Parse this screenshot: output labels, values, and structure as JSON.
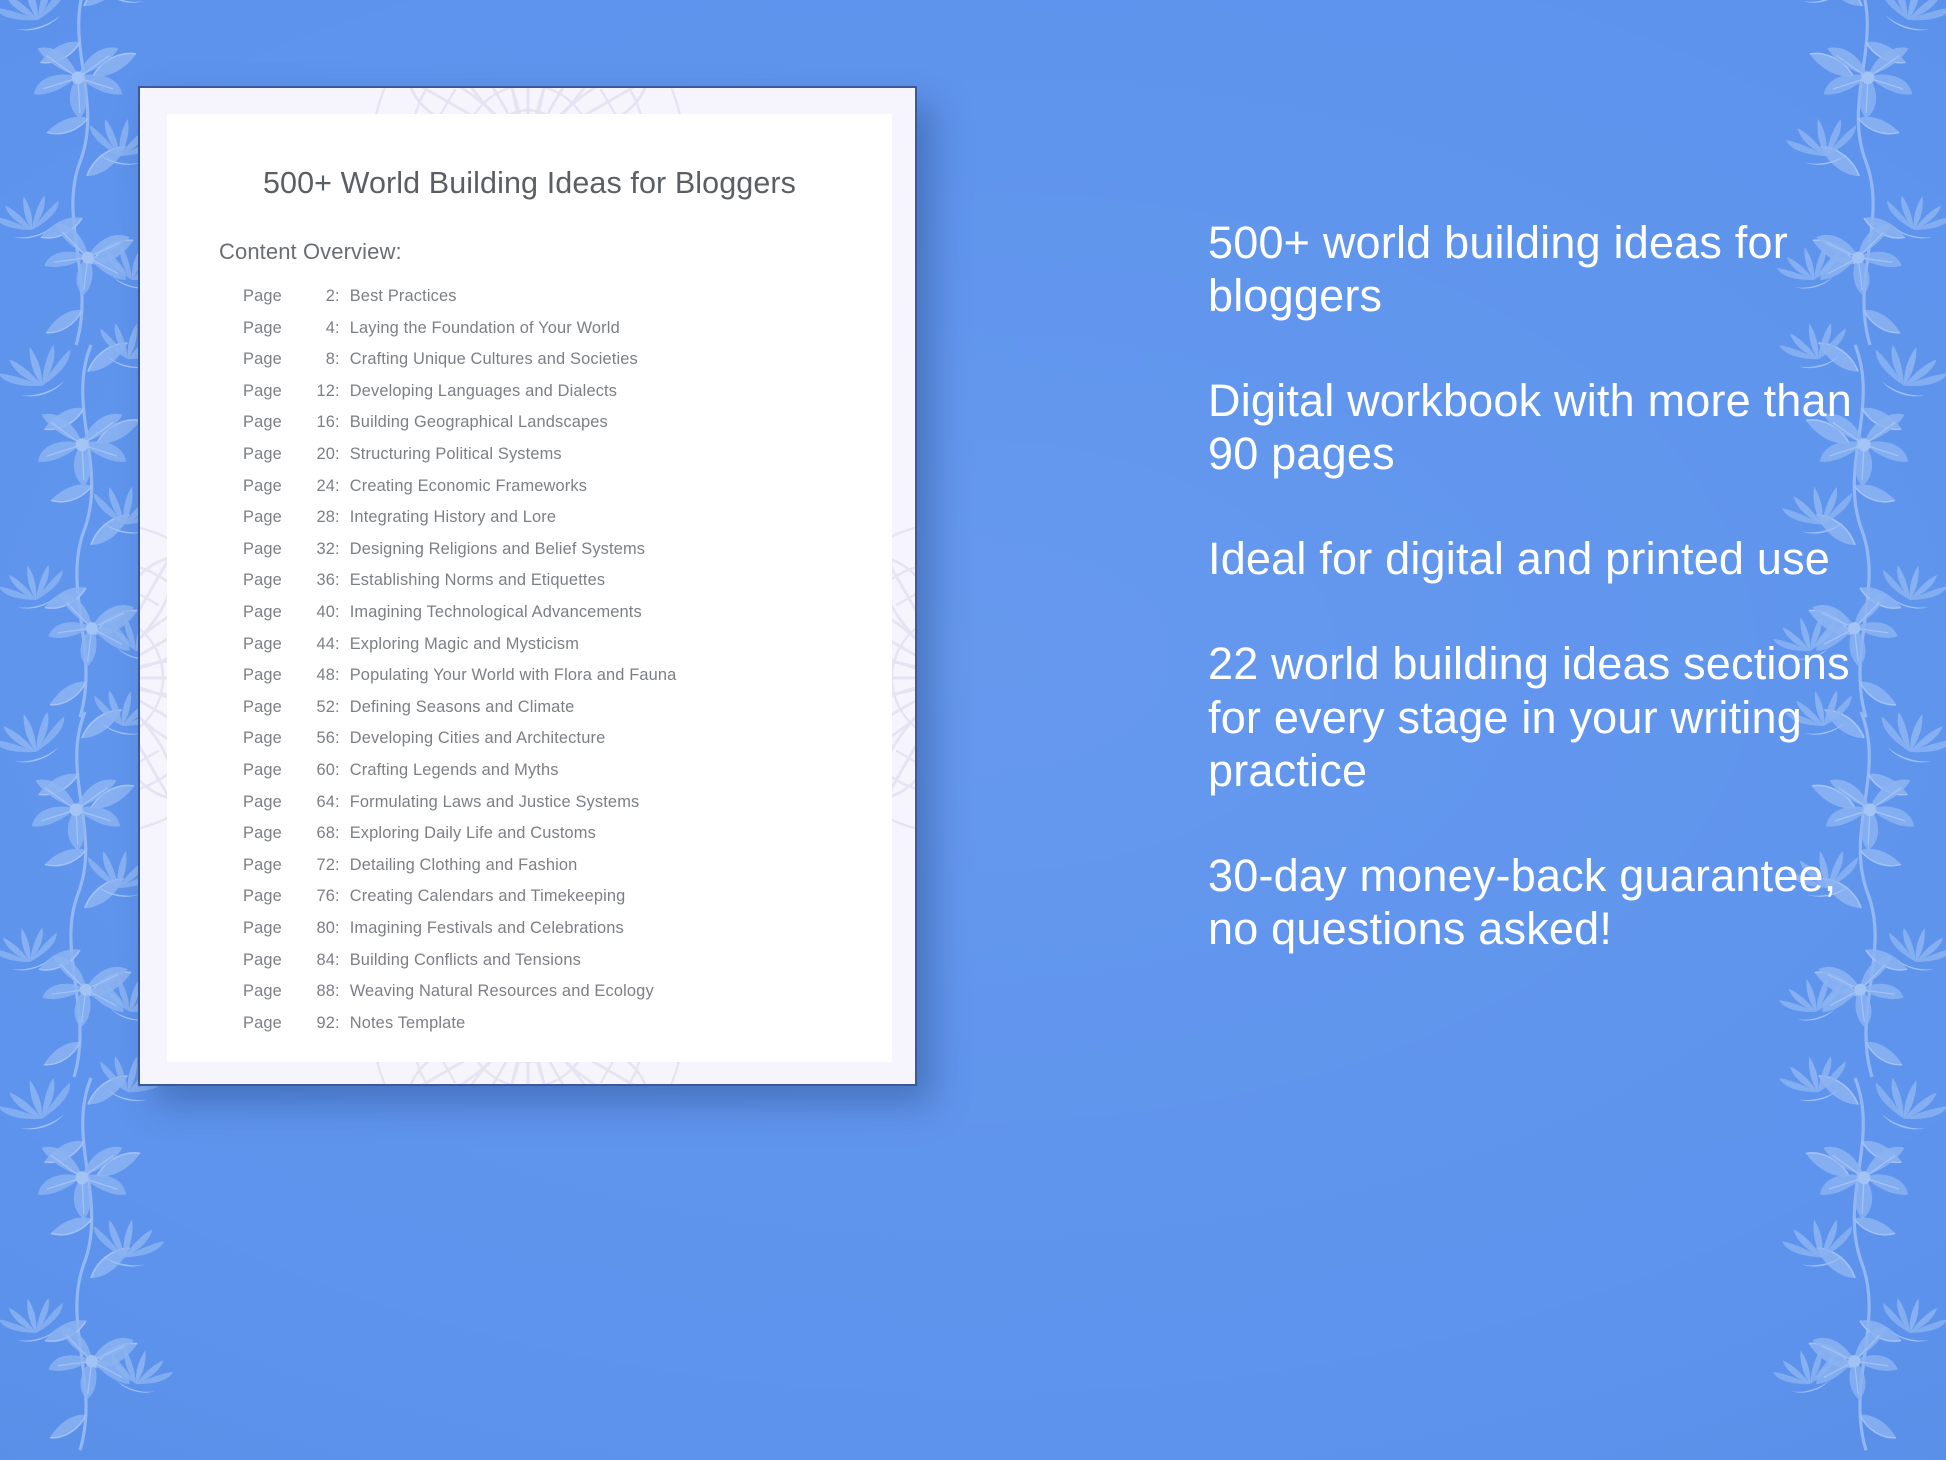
{
  "colors": {
    "background_blue": "#5d93ed",
    "floral_ornament": "#a9c8f5",
    "card_mat": "#f6f4fc",
    "card_border": "#3a5a9b",
    "page_white": "#ffffff",
    "title_text": "#5b5f63",
    "body_text": "#7b7f84",
    "marketing_text": "#ffffff"
  },
  "document": {
    "title": "500+ World Building Ideas for Bloggers",
    "overview_label": "Content Overview:",
    "toc": [
      {
        "page_word": "Page",
        "page": "2",
        "title": "Best Practices"
      },
      {
        "page_word": "Page",
        "page": "4",
        "title": "Laying the Foundation of Your World"
      },
      {
        "page_word": "Page",
        "page": "8",
        "title": "Crafting Unique Cultures and Societies"
      },
      {
        "page_word": "Page",
        "page": "12",
        "title": "Developing Languages and Dialects"
      },
      {
        "page_word": "Page",
        "page": "16",
        "title": "Building Geographical Landscapes"
      },
      {
        "page_word": "Page",
        "page": "20",
        "title": "Structuring Political Systems"
      },
      {
        "page_word": "Page",
        "page": "24",
        "title": "Creating Economic Frameworks"
      },
      {
        "page_word": "Page",
        "page": "28",
        "title": "Integrating History and Lore"
      },
      {
        "page_word": "Page",
        "page": "32",
        "title": "Designing Religions and Belief Systems"
      },
      {
        "page_word": "Page",
        "page": "36",
        "title": "Establishing Norms and Etiquettes"
      },
      {
        "page_word": "Page",
        "page": "40",
        "title": "Imagining Technological Advancements"
      },
      {
        "page_word": "Page",
        "page": "44",
        "title": "Exploring Magic and Mysticism"
      },
      {
        "page_word": "Page",
        "page": "48",
        "title": "Populating Your World with Flora and Fauna"
      },
      {
        "page_word": "Page",
        "page": "52",
        "title": "Defining Seasons and Climate"
      },
      {
        "page_word": "Page",
        "page": "56",
        "title": "Developing Cities and Architecture"
      },
      {
        "page_word": "Page",
        "page": "60",
        "title": "Crafting Legends and Myths"
      },
      {
        "page_word": "Page",
        "page": "64",
        "title": "Formulating Laws and Justice Systems"
      },
      {
        "page_word": "Page",
        "page": "68",
        "title": "Exploring Daily Life and Customs"
      },
      {
        "page_word": "Page",
        "page": "72",
        "title": "Detailing Clothing and Fashion"
      },
      {
        "page_word": "Page",
        "page": "76",
        "title": "Creating Calendars and Timekeeping"
      },
      {
        "page_word": "Page",
        "page": "80",
        "title": "Imagining Festivals and Celebrations"
      },
      {
        "page_word": "Page",
        "page": "84",
        "title": "Building Conflicts and Tensions"
      },
      {
        "page_word": "Page",
        "page": "88",
        "title": "Weaving Natural Resources and Ecology"
      },
      {
        "page_word": "Page",
        "page": "92",
        "title": "Notes Template"
      }
    ]
  },
  "marketing": {
    "bullets": [
      "500+ world building ideas for bloggers",
      "Digital workbook with more than 90 pages",
      "Ideal for digital and printed use",
      "22 world building ideas sections for every stage in your writing practice",
      "30-day money-back guarantee, no questions asked!"
    ]
  },
  "ornaments": {
    "left_border": "floral-vine-border-icon",
    "right_border": "floral-vine-border-icon",
    "page_watermark": "mandala-watermark-icon"
  }
}
